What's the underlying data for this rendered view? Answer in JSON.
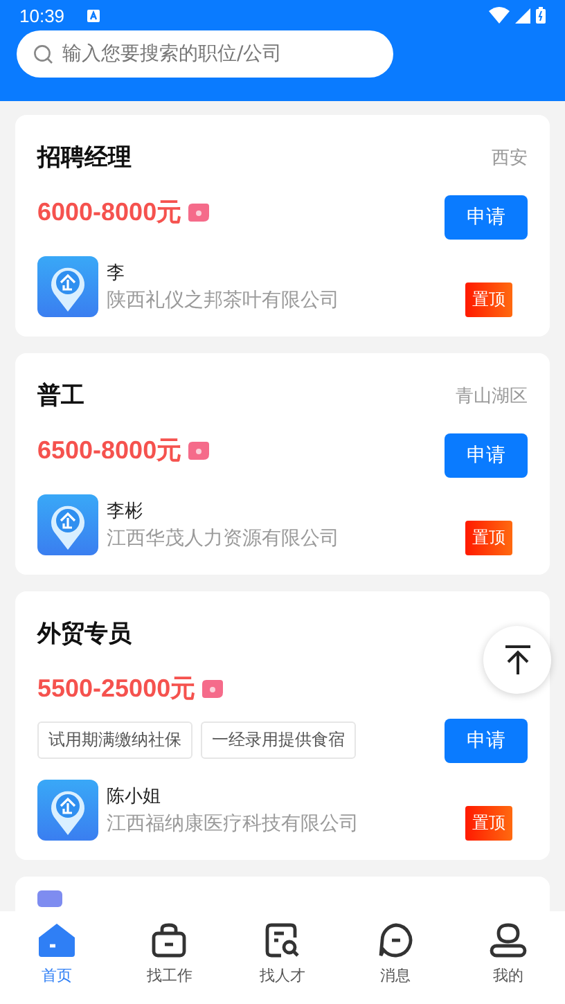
{
  "status_bar": {
    "time": "10:39"
  },
  "search": {
    "placeholder": "输入您要搜索的职位/公司"
  },
  "jobs": [
    {
      "title": "招聘经理",
      "location": "西安",
      "salary": "6000-8000元",
      "apply": "申请",
      "contact": "李",
      "company": "陕西礼仪之邦茶叶有限公司",
      "pinned": true,
      "pin_label": "置顶"
    },
    {
      "title": "普工",
      "location": "青山湖区",
      "salary": "6500-8000元",
      "apply": "申请",
      "contact": "李彬",
      "company": "江西华茂人力资源有限公司",
      "pinned": true,
      "pin_label": "置顶"
    },
    {
      "title": "外贸专员",
      "salary": "5500-25000元",
      "tags": [
        "试用期满缴纳社保",
        "一经录用提供食宿"
      ],
      "apply": "申请",
      "contact": "陈小姐",
      "company": "江西福纳康医疗科技有限公司",
      "pinned": true,
      "pin_label": "置顶"
    }
  ],
  "nav": [
    {
      "label": "首页",
      "kind": "home",
      "selected": true
    },
    {
      "label": "找工作",
      "kind": "jobs",
      "selected": false
    },
    {
      "label": "找人才",
      "kind": "talent",
      "selected": false
    },
    {
      "label": "消息",
      "kind": "messages",
      "selected": false
    },
    {
      "label": "我的",
      "kind": "profile",
      "selected": false
    }
  ]
}
